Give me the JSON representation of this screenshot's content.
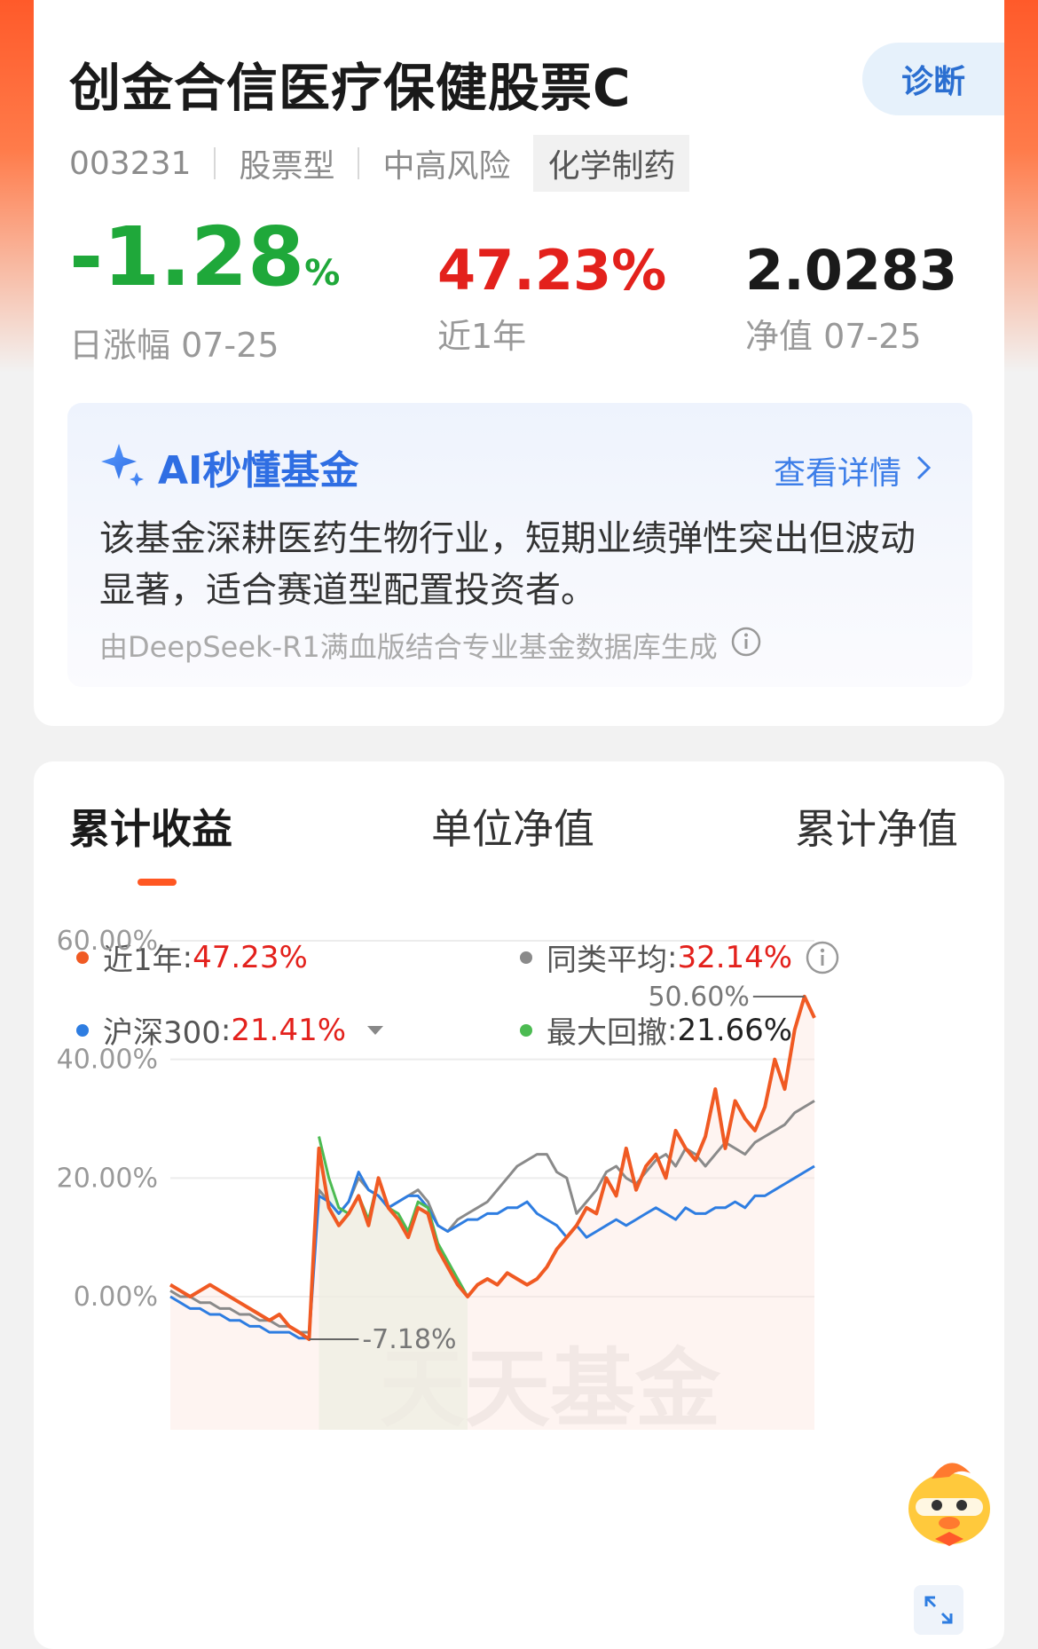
{
  "header": {
    "fund_name": "创金合信医疗保健股票C",
    "diagnose_label": "诊断",
    "code": "003231",
    "type": "股票型",
    "risk": "中高风险",
    "sector_tag": "化学制药"
  },
  "stats": {
    "daily_change": "-1.28",
    "daily_change_unit": "%",
    "daily_change_label": "日涨幅 07-25",
    "one_year": "47.23%",
    "one_year_label": "近1年",
    "nav": "2.0283",
    "nav_label": "净值 07-25"
  },
  "ai": {
    "title": "AI秒懂基金",
    "more_label": "查看详情",
    "summary": "该基金深耕医药生物行业，短期业绩弹性突出但波动显著，适合赛道型配置投资者。",
    "source": "由DeepSeek-R1满血版结合专业基金数据库生成"
  },
  "tabs": [
    {
      "label": "累计收益",
      "active": true
    },
    {
      "label": "单位净值",
      "active": false
    },
    {
      "label": "累计净值",
      "active": false
    }
  ],
  "legend": {
    "fund": {
      "name": "近1年",
      "value": "47.23%",
      "color": "#f05a23"
    },
    "peer": {
      "name": "同类平均",
      "value": "32.14%",
      "color": "#8a8a8a"
    },
    "index": {
      "name": "沪深300",
      "value": "21.41%",
      "color": "#2e7de1"
    },
    "drawdown": {
      "name": "最大回撤",
      "value": "21.66%",
      "color": "#4cbb52"
    }
  },
  "chart_data": {
    "type": "line",
    "ylim": [
      -7,
      60
    ],
    "y_ticks": [
      "60.00%",
      "40.00%",
      "20.00%",
      "0.00%"
    ],
    "y_tick_values": [
      60,
      40,
      20,
      0
    ],
    "annotations": {
      "max_label": "50.60%",
      "min_label": "-7.18%",
      "max": 50.6,
      "min": -7.18
    },
    "watermark": "天天基金",
    "series": [
      {
        "name": "近1年",
        "color": "#f05a23",
        "values": [
          2,
          1,
          0,
          1,
          2,
          1,
          0,
          -1,
          -2,
          -3,
          -4,
          -3,
          -5,
          -6,
          -7.18,
          25,
          15,
          12,
          14,
          17,
          12,
          20,
          15,
          13,
          10,
          15,
          14,
          8,
          5,
          2,
          0,
          2,
          3,
          2,
          4,
          3,
          2,
          3,
          5,
          8,
          10,
          12,
          15,
          14,
          20,
          17,
          25,
          18,
          22,
          24,
          20,
          28,
          25,
          23,
          27,
          35,
          25,
          33,
          30,
          28,
          32,
          40,
          35,
          45,
          50.6,
          47
        ]
      },
      {
        "name": "同类平均",
        "color": "#8a8a8a",
        "values": [
          1,
          0,
          0,
          -1,
          -1,
          -2,
          -2,
          -3,
          -3,
          -4,
          -4,
          -5,
          -5,
          -6,
          -6,
          18,
          16,
          14,
          16,
          20,
          18,
          17,
          15,
          16,
          17,
          18,
          16,
          12,
          11,
          13,
          14,
          15,
          16,
          18,
          20,
          22,
          23,
          24,
          24,
          21,
          20,
          14,
          16,
          18,
          21,
          22,
          20,
          19,
          21,
          23,
          24,
          22,
          25,
          24,
          22,
          24,
          26,
          25,
          24,
          26,
          27,
          28,
          29,
          31,
          32,
          33
        ]
      },
      {
        "name": "沪深300",
        "color": "#2e7de1",
        "values": [
          0,
          -1,
          -2,
          -2,
          -3,
          -3,
          -4,
          -4,
          -5,
          -5,
          -6,
          -6,
          -6,
          -7,
          -7,
          17,
          16,
          14,
          16,
          21,
          18,
          17,
          15,
          16,
          17,
          17,
          15,
          12,
          11,
          12,
          13,
          13,
          14,
          14,
          15,
          15,
          16,
          14,
          13,
          12,
          10,
          12,
          10,
          11,
          12,
          13,
          12,
          13,
          14,
          15,
          14,
          13,
          15,
          14,
          14,
          15,
          15,
          16,
          15,
          17,
          17,
          18,
          19,
          20,
          21,
          22
        ]
      },
      {
        "name": "最大回撤",
        "color": "#4cbb52",
        "values": [
          27,
          20,
          15,
          14,
          17,
          13,
          20,
          15,
          14,
          11,
          16,
          15,
          9,
          6,
          3,
          0
        ]
      }
    ]
  }
}
